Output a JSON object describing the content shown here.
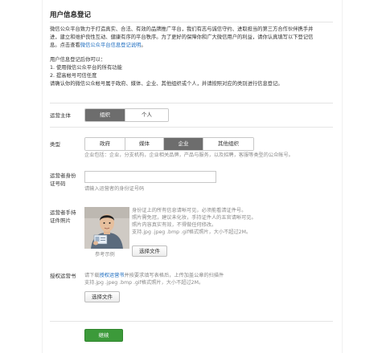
{
  "page": {
    "title": "用户信息登记",
    "intro_line1": "微信公众平台致力于打造真实、合法、有效的品牌推广平台，我们有志与诚信守约、进取担当的第三方合作伙伴携手并",
    "intro_line2": "进，建立和维护良性互动、健康有序的平台秩序。为了更好的保障你和广大微信用户的利益，请你认真填写以下登记信",
    "intro_line3_prefix": "息。点击查看",
    "intro_link": "微信公众平台信息登记说明",
    "intro_line3_suffix": "。",
    "after_title": "用户信息登记后你可以：",
    "after_item1": "1. 使用微信公众平台的所有功能",
    "after_item2": "2. 提高帐号可信任度",
    "after_note": "请确认你的微信公众帐号属于政府、媒体、企业、其他组织或个人，并请按照对应的类别进行信息登记。"
  },
  "operator": {
    "label": "运营主体",
    "options": [
      "组织",
      "个人"
    ],
    "selected": "组织"
  },
  "type": {
    "label": "类型",
    "options": [
      "政府",
      "媒体",
      "企业",
      "其他组织"
    ],
    "selected": "企业",
    "hint": "企业包括：企业，分支机构，企业相关品牌，产品与服务，以及招聘，客服等类型的公众帐号。"
  },
  "id_number": {
    "label_line1": "运营者身份",
    "label_line2": "证号码",
    "value": "",
    "hint": "请输入运营者的身份证号码"
  },
  "id_photo": {
    "label_line1": "运营者手持",
    "label_line2": "证件照片",
    "sample_caption": "参考示例",
    "hint1": "身份证上的所有信息请晰可见，必须能看清证件号。",
    "hint2": "照片需免冠，建议未化妆，手持证件人的五官请晰可见。",
    "hint3": "照片内容真实有效，不得做任何修改。",
    "hint4": "支持.jpg .jpeg .bmp .gif格式照片，大小不超过2M。",
    "upload_button": "选择文件"
  },
  "auth_letter": {
    "label": "授权运营书",
    "hint1_prefix": "请下载",
    "hint1_link": "授权运营书",
    "hint1_suffix": "并按要求填写表格后，上传加盖公章的扫描件",
    "hint2": "支持.jpg .jpeg .bmp .gif格式照片，大小不超过2M。",
    "upload_button": "选择文件"
  },
  "footer": {
    "continue_button": "继续"
  },
  "colors": {
    "selected_segment": "#6d6d6d",
    "link": "#1a6bbf",
    "primary_button": "#3c9a3a"
  }
}
